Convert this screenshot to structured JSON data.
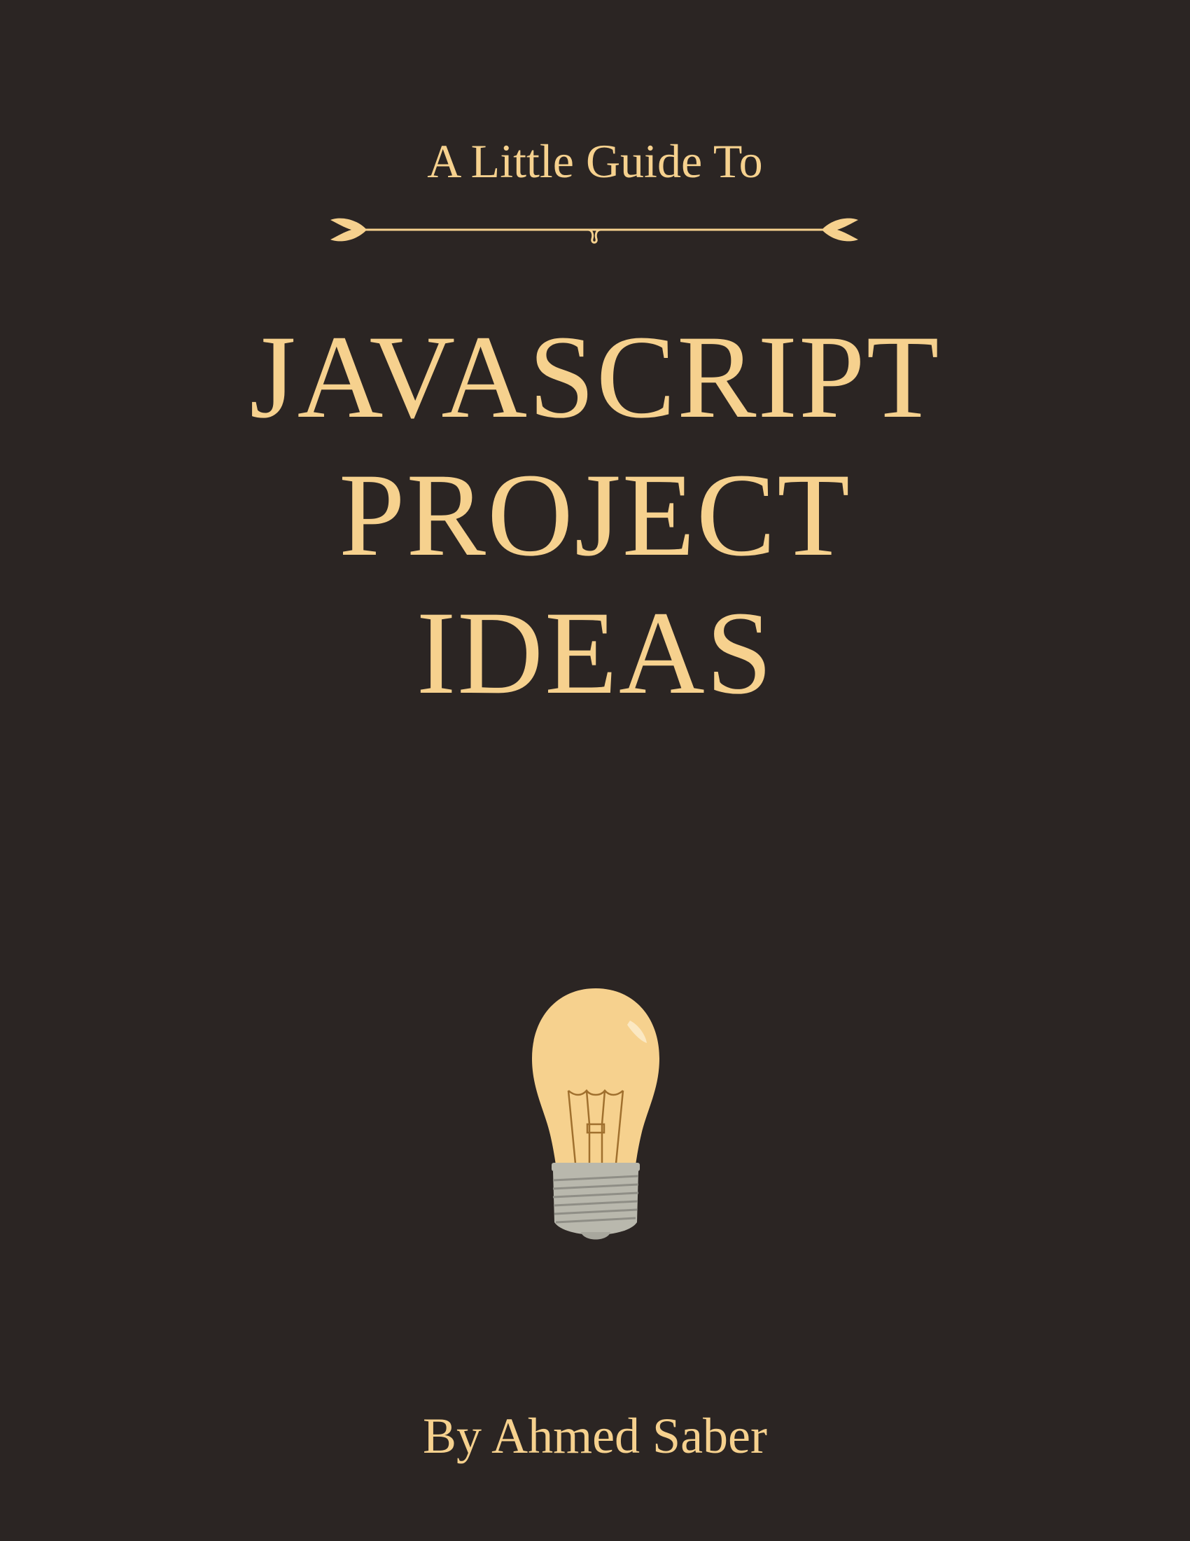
{
  "cover": {
    "subtitle": "A Little Guide To",
    "title_lines": [
      "JAVASCRIPT",
      "PROJECT",
      "IDEAS"
    ],
    "author": "By Ahmed Saber"
  },
  "icons": {
    "divider": "ornamental-divider-icon",
    "illustration": "lightbulb-icon"
  },
  "colors": {
    "background": "#2b2523",
    "accent": "#f6d18e",
    "bulb_glass": "#f6d18e",
    "bulb_base": "#b9b8ad",
    "filament": "#a0702e"
  }
}
